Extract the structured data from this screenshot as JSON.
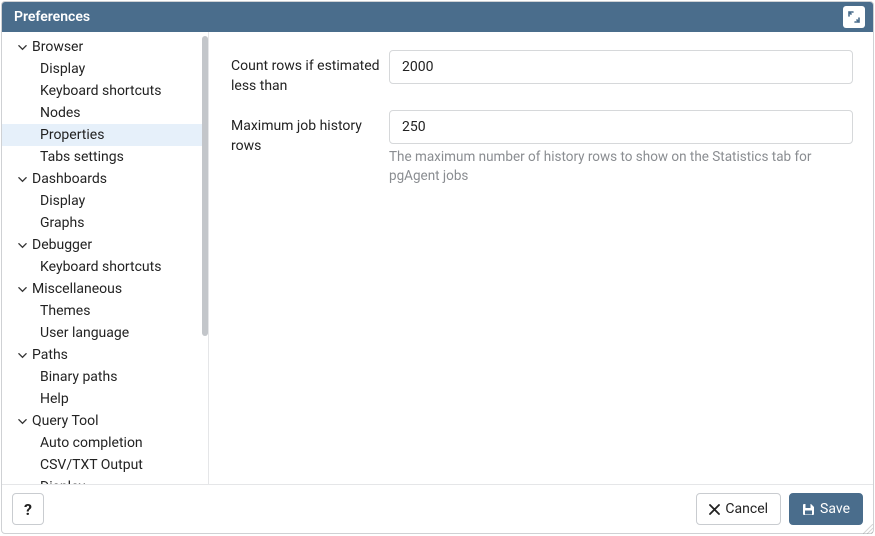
{
  "window": {
    "title": "Preferences"
  },
  "sidebar": {
    "groups": [
      {
        "label": "Browser",
        "expanded": true,
        "items": [
          {
            "label": "Display"
          },
          {
            "label": "Keyboard shortcuts"
          },
          {
            "label": "Nodes"
          },
          {
            "label": "Properties",
            "selected": true
          },
          {
            "label": "Tabs settings"
          }
        ]
      },
      {
        "label": "Dashboards",
        "expanded": true,
        "items": [
          {
            "label": "Display"
          },
          {
            "label": "Graphs"
          }
        ]
      },
      {
        "label": "Debugger",
        "expanded": true,
        "items": [
          {
            "label": "Keyboard shortcuts"
          }
        ]
      },
      {
        "label": "Miscellaneous",
        "expanded": true,
        "items": [
          {
            "label": "Themes"
          },
          {
            "label": "User language"
          }
        ]
      },
      {
        "label": "Paths",
        "expanded": true,
        "items": [
          {
            "label": "Binary paths"
          },
          {
            "label": "Help"
          }
        ]
      },
      {
        "label": "Query Tool",
        "expanded": true,
        "items": [
          {
            "label": "Auto completion"
          },
          {
            "label": "CSV/TXT Output"
          },
          {
            "label": "Display"
          }
        ]
      }
    ]
  },
  "form": {
    "count_rows": {
      "label": "Count rows if estimated less than",
      "value": "2000"
    },
    "max_history": {
      "label": "Maximum job history rows",
      "value": "250",
      "help": "The maximum number of history rows to show on the Statistics tab for pgAgent jobs"
    }
  },
  "footer": {
    "help_label": "?",
    "cancel_label": "Cancel",
    "save_label": "Save"
  }
}
